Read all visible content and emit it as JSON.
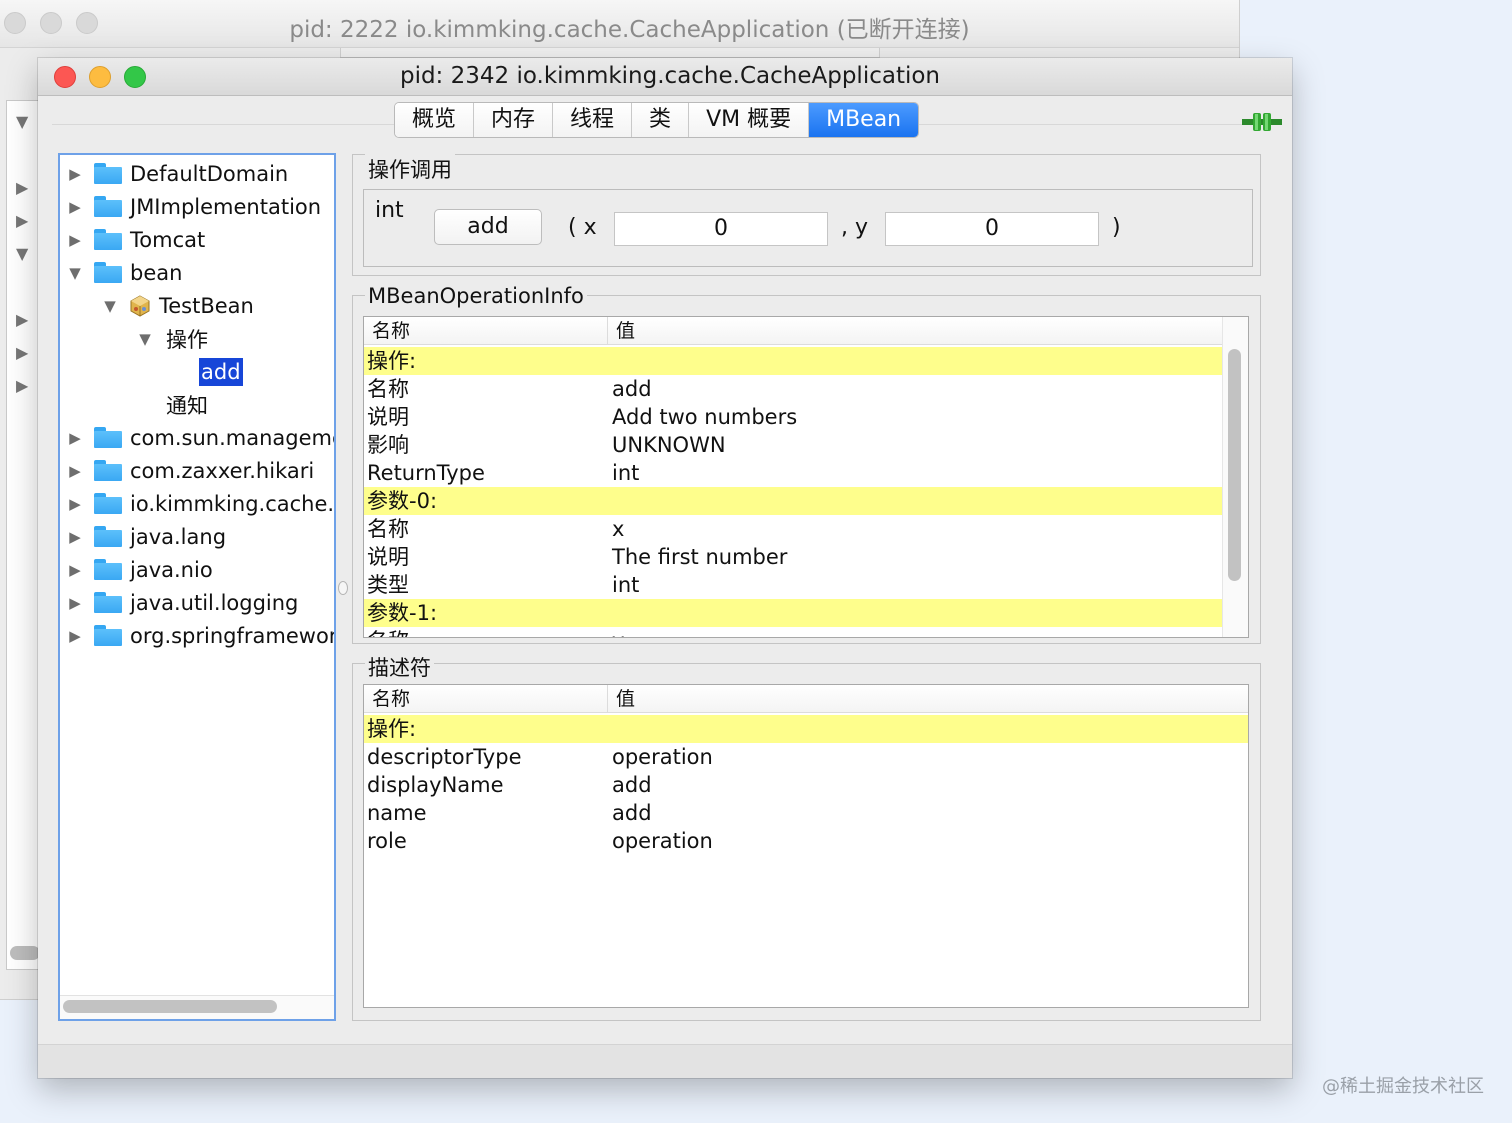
{
  "background_window": {
    "title": "pid: 2222 io.kimmking.cache.CacheApplication (已断开连接)"
  },
  "window": {
    "title": "pid: 2342 io.kimmking.cache.CacheApplication"
  },
  "tabs": [
    {
      "label": "概览",
      "active": false
    },
    {
      "label": "内存",
      "active": false
    },
    {
      "label": "线程",
      "active": false
    },
    {
      "label": "类",
      "active": false
    },
    {
      "label": "VM 概要",
      "active": false
    },
    {
      "label": "MBean",
      "active": true
    }
  ],
  "tree": {
    "items": [
      {
        "label": "DefaultDomain",
        "icon": "folder-icon",
        "expanded": false
      },
      {
        "label": "JMImplementation",
        "icon": "folder-icon",
        "expanded": false
      },
      {
        "label": "Tomcat",
        "icon": "folder-icon",
        "expanded": false
      },
      {
        "label": "bean",
        "icon": "folder-icon",
        "expanded": true
      },
      {
        "label": "TestBean",
        "icon": "bean-icon",
        "expanded": true
      },
      {
        "label": "操作",
        "icon": "",
        "expanded": true
      },
      {
        "label": "add",
        "icon": "",
        "selected": true
      },
      {
        "label": "通知",
        "icon": ""
      },
      {
        "label": "com.sun.manageme",
        "icon": "folder-icon",
        "expanded": false
      },
      {
        "label": "com.zaxxer.hikari",
        "icon": "folder-icon",
        "expanded": false
      },
      {
        "label": "io.kimmking.cache.s",
        "icon": "folder-icon",
        "expanded": false
      },
      {
        "label": "java.lang",
        "icon": "folder-icon",
        "expanded": false
      },
      {
        "label": "java.nio",
        "icon": "folder-icon",
        "expanded": false
      },
      {
        "label": "java.util.logging",
        "icon": "folder-icon",
        "expanded": false
      },
      {
        "label": "org.springframeworl",
        "icon": "folder-icon",
        "expanded": false
      }
    ]
  },
  "operation_panel": {
    "title": "操作调用",
    "return_type": "int",
    "button_label": "add",
    "open_paren": "( x",
    "comma": ", y",
    "close_paren": ")",
    "x_value": "0",
    "y_value": "0"
  },
  "info_panel": {
    "title": "MBeanOperationInfo",
    "columns": [
      "名称",
      "值"
    ],
    "rows": [
      {
        "name": "操作:",
        "value": "",
        "highlight": true
      },
      {
        "name": "名称",
        "value": "add"
      },
      {
        "name": "说明",
        "value": "Add two numbers"
      },
      {
        "name": "影响",
        "value": "UNKNOWN"
      },
      {
        "name": "ReturnType",
        "value": "int"
      },
      {
        "name": "参数-0:",
        "value": "",
        "highlight": true
      },
      {
        "name": "名称",
        "value": "x"
      },
      {
        "name": "说明",
        "value": "The first number"
      },
      {
        "name": "类型",
        "value": "int"
      },
      {
        "name": "参数-1:",
        "value": "",
        "highlight": true
      },
      {
        "name": "名称",
        "value": "y"
      }
    ]
  },
  "descriptor_panel": {
    "title": "描述符",
    "columns": [
      "名称",
      "值"
    ],
    "rows": [
      {
        "name": "操作:",
        "value": "",
        "highlight": true
      },
      {
        "name": "descriptorType",
        "value": "operation"
      },
      {
        "name": "displayName",
        "value": "add"
      },
      {
        "name": "name",
        "value": "add"
      },
      {
        "name": "role",
        "value": "operation"
      }
    ]
  },
  "watermark": "@稀土掘金技术社区",
  "colors": {
    "highlight_row": "#fefe8c",
    "selection": "#1746d8",
    "active_tab": "#1a73f0",
    "folder": "#3aa8f3"
  }
}
